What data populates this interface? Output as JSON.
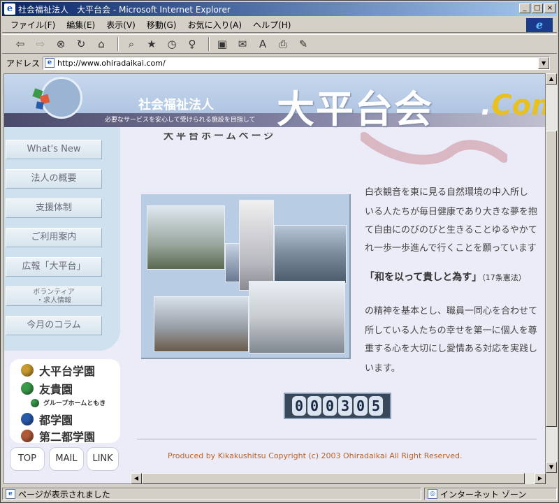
{
  "window": {
    "title": "社会福祉法人　大平台会 - Microsoft Internet Explorer",
    "controls": [
      "_",
      "□",
      "×"
    ]
  },
  "menu": [
    "ファイル(F)",
    "編集(E)",
    "表示(V)",
    "移動(G)",
    "お気に入り(A)",
    "ヘルプ(H)"
  ],
  "toolbar": {
    "icons": [
      "back-icon",
      "forward-icon",
      "stop-icon",
      "refresh-icon",
      "home-icon",
      "search-icon",
      "favorites-icon",
      "history-icon",
      "channels-icon",
      "fullscreen-icon",
      "mail-icon",
      "font-icon",
      "print-icon",
      "edit-icon"
    ],
    "back": "⇦",
    "forward": "⇨",
    "stop": "⊗",
    "refresh": "↻",
    "home": "⌂",
    "search": "⌕",
    "favorites": "★",
    "history": "◷",
    "channels": "♀",
    "fullscreen": "▣",
    "mail": "✉",
    "font": "A",
    "print": "⎙",
    "edit": "✎"
  },
  "address": {
    "label": "アドレス",
    "url": "http://www.ohiradaikai.com/"
  },
  "banner": {
    "corp_label": "社会福祉法人",
    "tagline": "必要なサービスを安心して受けられる施設を目指して",
    "name": "大平台会",
    "dot": ".",
    "com_c": "C",
    "com_rest": "om"
  },
  "nav": [
    "What's New",
    "法人の概要",
    "支援体制",
    "ご利用案内",
    "広報「大平台」",
    "ボランティア",
    "・求人情報",
    "今月のコラム"
  ],
  "facilities": [
    {
      "label": "大平台学園",
      "color": "#c89a30"
    },
    {
      "label": "友貴園",
      "color": "#3a9a4a"
    },
    {
      "label": "グループホームともき",
      "color": "#3a9a4a"
    },
    {
      "label": "都学園",
      "color": "#2a5aaa"
    },
    {
      "label": "第二都学園",
      "color": "#b05a3a"
    }
  ],
  "buttons": {
    "top": "TOP",
    "mail": "MAIL",
    "link": "LINK"
  },
  "content": {
    "title_fragment": "大平台ホームページ",
    "para1": [
      "白衣観音を東に見る自然環境の中入所し",
      "いる人たちが毎日健康であり大きな夢を抱",
      "て自由にのびのびと生きることゆるやかて",
      "れ一歩一歩進んで行くことを願っています"
    ],
    "quote": "「和を以って貴しと為す」",
    "quote_note": "（17条憲法）",
    "para2": [
      "の精神を基本とし、職員一同心を合わせて",
      "所している人たちの幸せを第一に個人を尊",
      "重する心を大切にし愛情ある対応を実践し",
      "います。"
    ],
    "counter": [
      "0",
      "0",
      "0",
      "3",
      "0",
      "5"
    ],
    "footer": "Produced by Kikakushitsu Copyright (c) 2003 Ohiradaikai All Right Reserved."
  },
  "status": {
    "message": "ページが表示されました",
    "zone": "インターネット ゾーン"
  }
}
